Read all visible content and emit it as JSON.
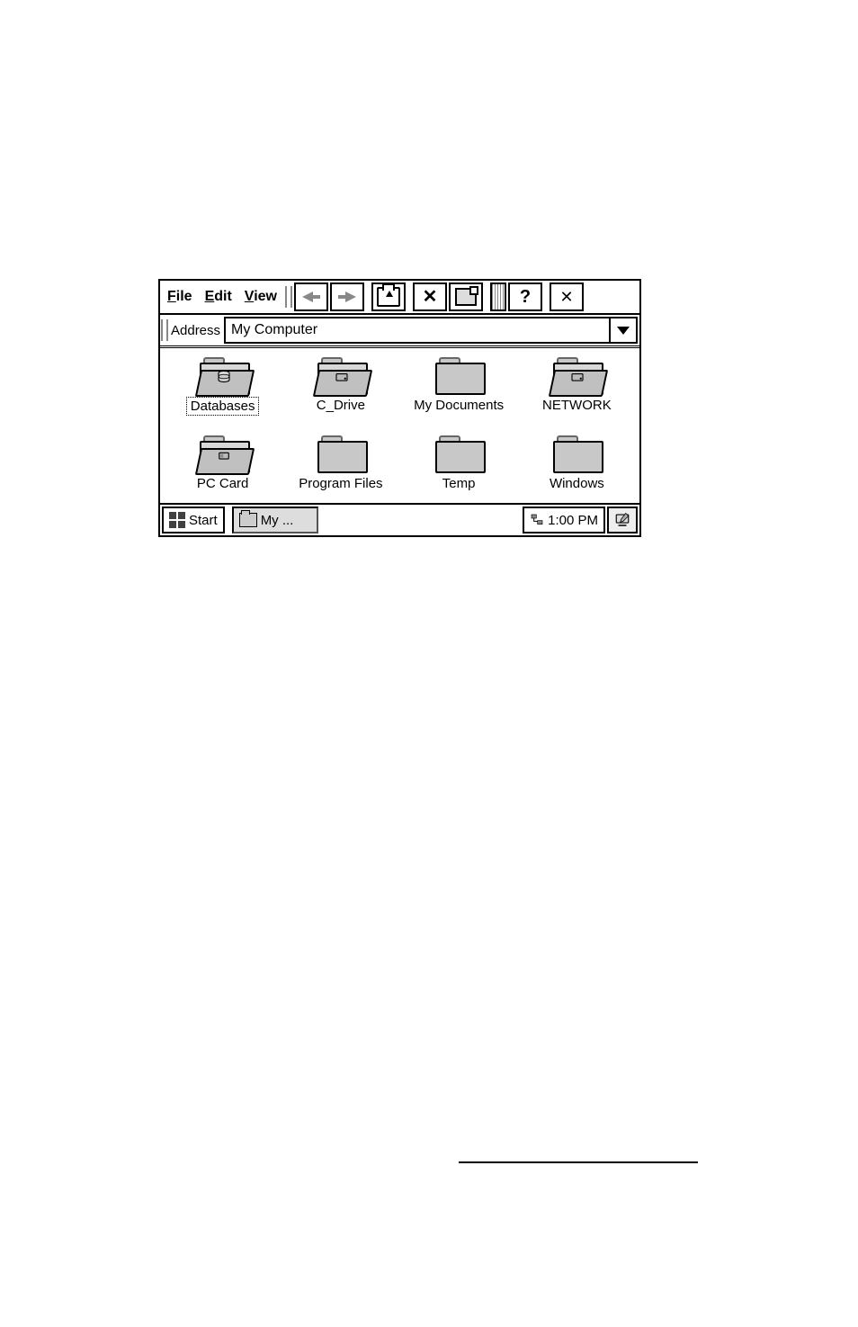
{
  "menu": {
    "file": "File",
    "edit": "Edit",
    "view": "View"
  },
  "toolbar": {
    "help": "?"
  },
  "addressbar": {
    "label": "Address",
    "value": "My Computer"
  },
  "items": [
    {
      "label": "Databases",
      "selected": true,
      "type": "open-db"
    },
    {
      "label": "C_Drive",
      "selected": false,
      "type": "open-drive"
    },
    {
      "label": "My Documents",
      "selected": false,
      "type": "folder"
    },
    {
      "label": "NETWORK",
      "selected": false,
      "type": "open-drive"
    },
    {
      "label": "PC Card",
      "selected": false,
      "type": "open-card"
    },
    {
      "label": "Program Files",
      "selected": false,
      "type": "folder"
    },
    {
      "label": "Temp",
      "selected": false,
      "type": "folder"
    },
    {
      "label": "Windows",
      "selected": false,
      "type": "folder"
    }
  ],
  "taskbar": {
    "start": "Start",
    "task": "My ...",
    "clock": "1:00 PM"
  }
}
